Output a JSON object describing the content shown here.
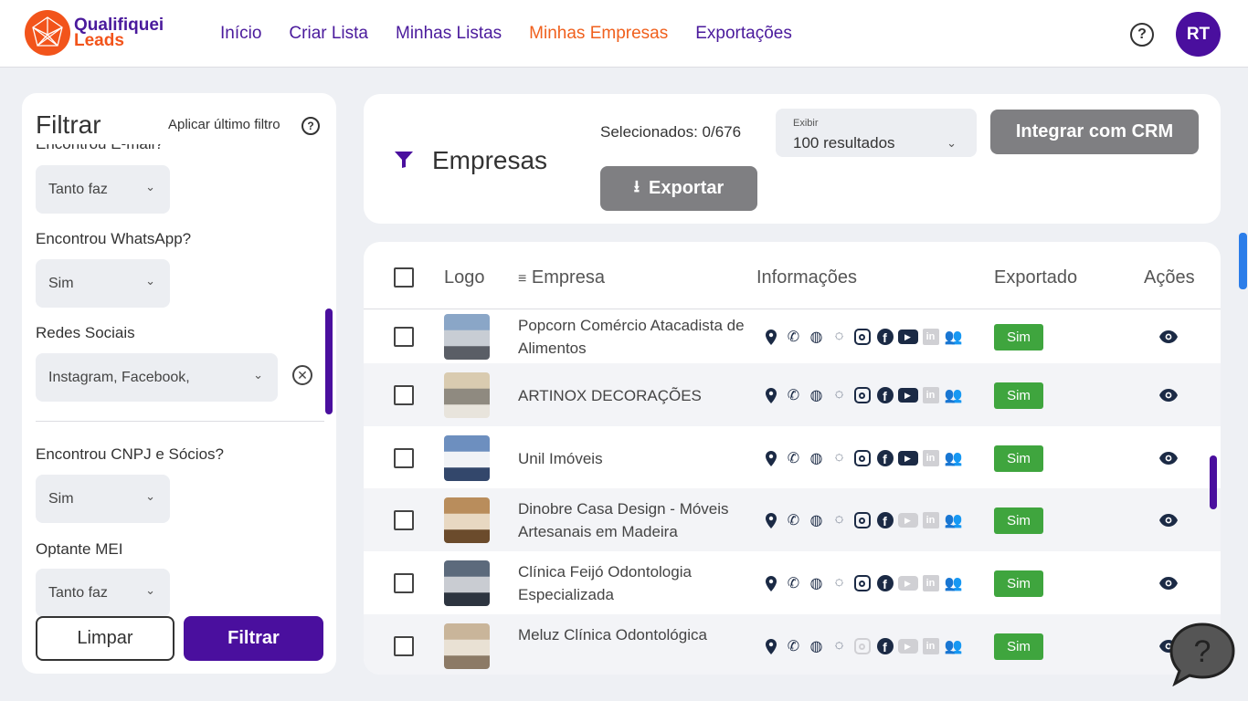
{
  "app": {
    "name_line1": "Qualifiquei",
    "name_line2": "Leads"
  },
  "nav": {
    "items": [
      {
        "label": "Início"
      },
      {
        "label": "Criar Lista"
      },
      {
        "label": "Minhas Listas"
      },
      {
        "label": "Minhas Empresas",
        "active": true
      },
      {
        "label": "Exportações"
      }
    ]
  },
  "user": {
    "initials": "RT"
  },
  "filters": {
    "title": "Filtrar",
    "apply_last": "Aplicar último filtro",
    "fields": [
      {
        "label": "Encontrou E-mail?",
        "value": "Tanto faz"
      },
      {
        "label": "Encontrou WhatsApp?",
        "value": "Sim"
      },
      {
        "label": "Redes Sociais",
        "value": "Instagram, Facebook,"
      },
      {
        "label": "Encontrou CNPJ e Sócios?",
        "value": "Sim"
      },
      {
        "label": "Optante MEI",
        "value": "Tanto faz"
      }
    ],
    "clear_label": "Limpar",
    "filter_label": "Filtrar"
  },
  "header": {
    "title": "Empresas",
    "selected": "Selecionados: 0/676",
    "show_caption": "Exibir",
    "show_value": "100 resultados",
    "crm_label": "Integrar com CRM",
    "export_label": "Exportar"
  },
  "table": {
    "columns": [
      "Logo",
      "Empresa",
      "Informações",
      "Exportado",
      "Ações"
    ],
    "rows": [
      {
        "name": "Popcorn Comércio Atacadista de Alimentos",
        "exported": "Sim",
        "instagram": true,
        "youtube": true,
        "linkedin": false
      },
      {
        "name": "ARTINOX DECORAÇÕES",
        "exported": "Sim",
        "instagram": true,
        "youtube": true,
        "linkedin": false
      },
      {
        "name": "Unil Imóveis",
        "exported": "Sim",
        "instagram": true,
        "youtube": true,
        "linkedin": false
      },
      {
        "name": "Dinobre Casa Design - Móveis Artesanais em Madeira",
        "exported": "Sim",
        "instagram": true,
        "youtube": false,
        "linkedin": false
      },
      {
        "name": "Clínica Feijó Odontologia Especializada",
        "exported": "Sim",
        "instagram": true,
        "youtube": false,
        "linkedin": false
      },
      {
        "name": "Meluz Clínica Odontológica",
        "exported": "Sim",
        "instagram": false,
        "youtube": false,
        "linkedin": false
      }
    ]
  },
  "colors": {
    "brand_purple": "#4a0f9e",
    "brand_orange": "#f2541b",
    "success": "#3fa53e"
  }
}
